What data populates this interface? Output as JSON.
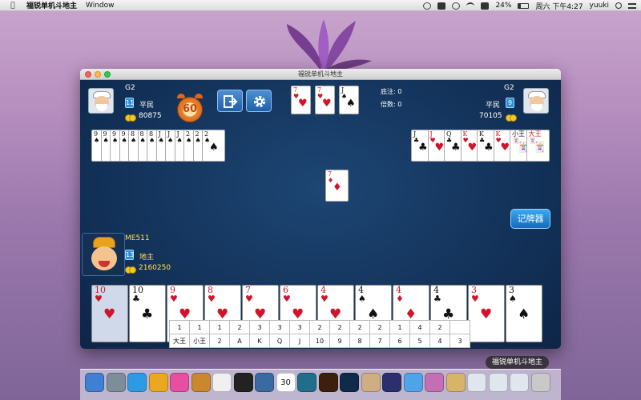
{
  "menubar": {
    "app_name": "福锐单机斗地主",
    "menus": [
      "Window"
    ],
    "battery": "24%",
    "datetime": "周六 下午4:27",
    "user": "yuuki"
  },
  "window": {
    "title": "福锐单机斗地主"
  },
  "players": {
    "left": {
      "name": "G2",
      "level": "11",
      "role": "平民",
      "coins": "80875"
    },
    "right": {
      "name": "G2",
      "level": "9",
      "role": "平民",
      "coins": "70105"
    },
    "me": {
      "name": "ME511",
      "level": "13",
      "role": "地主",
      "coins": "2160250"
    }
  },
  "timer": "60",
  "info": {
    "bet_label": "底注:",
    "bet_value": "0",
    "multiplier_label": "倍数:",
    "multiplier_value": "0"
  },
  "landlord_cards": [
    {
      "rank": "7",
      "suit": "♥",
      "color": "red"
    },
    {
      "rank": "7",
      "suit": "♥",
      "color": "red"
    },
    {
      "rank": "J",
      "suit": "♠",
      "color": "blk"
    }
  ],
  "left_cards": [
    {
      "rank": "9",
      "suit": "♠",
      "color": "blk"
    },
    {
      "rank": "9",
      "suit": "♠",
      "color": "blk"
    },
    {
      "rank": "9",
      "suit": "♠",
      "color": "blk"
    },
    {
      "rank": "9",
      "suit": "♠",
      "color": "blk"
    },
    {
      "rank": "8",
      "suit": "♠",
      "color": "blk"
    },
    {
      "rank": "8",
      "suit": "♠",
      "color": "blk"
    },
    {
      "rank": "8",
      "suit": "♠",
      "color": "blk"
    },
    {
      "rank": "J",
      "suit": "♠",
      "color": "blk"
    },
    {
      "rank": "J",
      "suit": "♠",
      "color": "blk"
    },
    {
      "rank": "J",
      "suit": "♠",
      "color": "blk"
    },
    {
      "rank": "2",
      "suit": "♠",
      "color": "blk"
    },
    {
      "rank": "2",
      "suit": "♠",
      "color": "blk"
    },
    {
      "rank": "2",
      "suit": "♠",
      "color": "blk"
    }
  ],
  "right_cards": [
    {
      "rank": "J",
      "suit": "♣",
      "color": "blk"
    },
    {
      "rank": "J",
      "suit": "♥",
      "color": "red"
    },
    {
      "rank": "Q",
      "suit": "♣",
      "color": "blk"
    },
    {
      "rank": "K",
      "suit": "♥",
      "color": "red"
    },
    {
      "rank": "K",
      "suit": "♣",
      "color": "blk"
    },
    {
      "rank": "K",
      "suit": "♥",
      "color": "red"
    },
    {
      "rank": "小王",
      "suit": "🃏",
      "color": "blk"
    },
    {
      "rank": "大王",
      "suit": "🃏",
      "color": "red"
    }
  ],
  "played_card": {
    "rank": "7",
    "suit": "♦",
    "color": "red"
  },
  "record_button": "记牌器",
  "hand_cards": [
    {
      "rank": "10",
      "suit": "♥",
      "color": "red"
    },
    {
      "rank": "10",
      "suit": "♣",
      "color": "blk"
    },
    {
      "rank": "9",
      "suit": "♥",
      "color": "red"
    },
    {
      "rank": "8",
      "suit": "♥",
      "color": "red"
    },
    {
      "rank": "7",
      "suit": "♥",
      "color": "red"
    },
    {
      "rank": "6",
      "suit": "♥",
      "color": "red"
    },
    {
      "rank": "4",
      "suit": "♥",
      "color": "red"
    },
    {
      "rank": "4",
      "suit": "♠",
      "color": "blk"
    },
    {
      "rank": "4",
      "suit": "♦",
      "color": "red"
    },
    {
      "rank": "4",
      "suit": "♣",
      "color": "blk"
    },
    {
      "rank": "3",
      "suit": "♥",
      "color": "red"
    },
    {
      "rank": "3",
      "suit": "♠",
      "color": "blk"
    }
  ],
  "counter": {
    "counts": [
      "1",
      "1",
      "1",
      "2",
      "3",
      "3",
      "3",
      "2",
      "2",
      "2",
      "2",
      "1",
      "4",
      "2"
    ],
    "labels": [
      "大王",
      "小王",
      "2",
      "A",
      "K",
      "Q",
      "J",
      "10",
      "9",
      "8",
      "7",
      "6",
      "5",
      "4",
      "3"
    ]
  },
  "dock": {
    "tooltip": "福锐单机斗地主",
    "icons": [
      "finder-icon",
      "launchpad-icon",
      "safari-icon",
      "chrome-icon",
      "itunes-icon",
      "app-icon",
      "textedit-icon",
      "terminal-icon",
      "font-icon",
      "calendar-icon",
      "maya-icon",
      "illustrator-icon",
      "photoshop-icon",
      "brush-icon",
      "eclipse-icon",
      "xcode-icon",
      "photo-icon",
      "game-icon",
      "window-icon",
      "window-icon",
      "window-icon",
      "trash-icon"
    ],
    "colors": [
      "#3f7fd4",
      "#7d8d99",
      "#2d9be3",
      "#e9a81f",
      "#e74fa0",
      "#c9882d",
      "#f0f0f0",
      "#222222",
      "#3b6aa0",
      "#ffffff",
      "#1f6f8b",
      "#3d1f0e",
      "#0f2a4a",
      "#cfae84",
      "#2b2f6e",
      "#4fa3e8",
      "#c46fb5",
      "#d8b36a",
      "#dfe6ee",
      "#dfe6ee",
      "#dfe6ee",
      "#c9c9c9"
    ],
    "calendar_day": "30"
  }
}
